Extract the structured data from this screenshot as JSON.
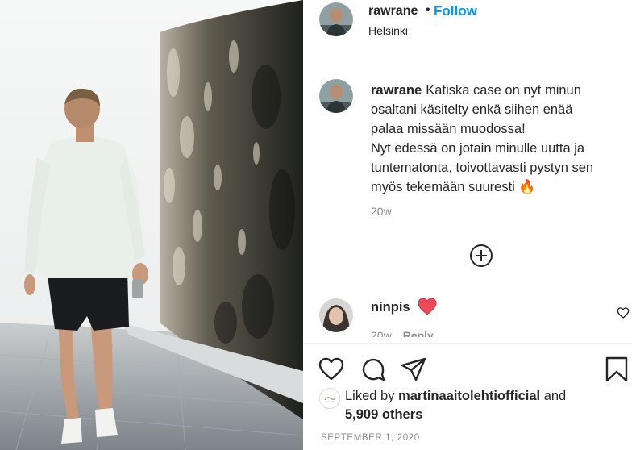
{
  "post": {
    "username": "rawrane",
    "separator": "•",
    "follow_label": "Follow",
    "location": "Helsinki"
  },
  "caption": {
    "username": "rawrane",
    "lines": [
      "Katiska case on nyt minun",
      "osaltani käsitelty enkä siihen enää",
      "palaa missään muodossa!",
      "Nyt edessä on jotain minulle uutta ja",
      "tuntematonta, toivottavasti pystyn sen",
      "myös tekemään suuresti"
    ],
    "emoji": "🔥",
    "time": "20w"
  },
  "comment": {
    "username": "ninpis",
    "time": "20w",
    "reply_label": "Reply"
  },
  "likes": {
    "prefix": "Liked by",
    "user": "martinaaitolehtiofficial",
    "conjunction": "and",
    "others": "5,909 others"
  },
  "date": "SEPTEMBER 1, 2020",
  "icons": {
    "load_more": "plus-circle-icon",
    "comment_emoji": "red-heart-icon",
    "comment_like": "heart-outline-icon",
    "like": "heart-outline-icon",
    "comment": "speech-bubble-icon",
    "share": "paper-plane-icon",
    "save": "bookmark-icon"
  },
  "colors": {
    "follow": "#0095f6",
    "text": "#262626",
    "secondary": "#8e8e8e",
    "divider": "#efefef",
    "heart": "#ed4956"
  }
}
